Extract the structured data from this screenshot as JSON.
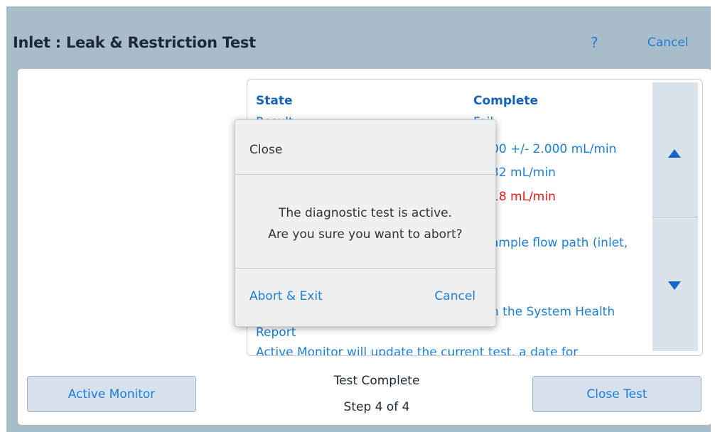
{
  "header": {
    "title": "Inlet : Leak & Restriction Test",
    "help_label": "?",
    "cancel_label": "Cancel"
  },
  "results": {
    "col1_header": "State",
    "col2_header": "Complete",
    "rows": [
      {
        "col1": "Result",
        "col2": "Fail"
      },
      {
        "col1": "",
        "col2": "00 +/- 2.000 mL/min"
      },
      {
        "col1": "",
        "col2": "32 mL/min"
      },
      {
        "col1": "",
        "col2": "18 mL/min"
      },
      {
        "col1": "",
        "col2": "ample flow path (inlet,"
      },
      {
        "col1": "",
        "col2": "n the System Health"
      },
      {
        "col1": "Report",
        "col2": ""
      },
      {
        "col1": "Active Monitor will update the current test, a date for",
        "col2": ""
      }
    ]
  },
  "footer": {
    "active_monitor_label": "Active Monitor",
    "status_title": "Test Complete",
    "status_step": "Step 4 of 4",
    "close_test_label": "Close Test"
  },
  "dialog": {
    "title": "Close",
    "message_line1": "The diagnostic test is active.",
    "message_line2": "Are you sure you want to abort?",
    "abort_label": "Abort & Exit",
    "cancel_label": "Cancel"
  },
  "colors": {
    "accent": "#1d7fd8",
    "error": "#e11a1a",
    "frame": "#a9bcc9"
  }
}
